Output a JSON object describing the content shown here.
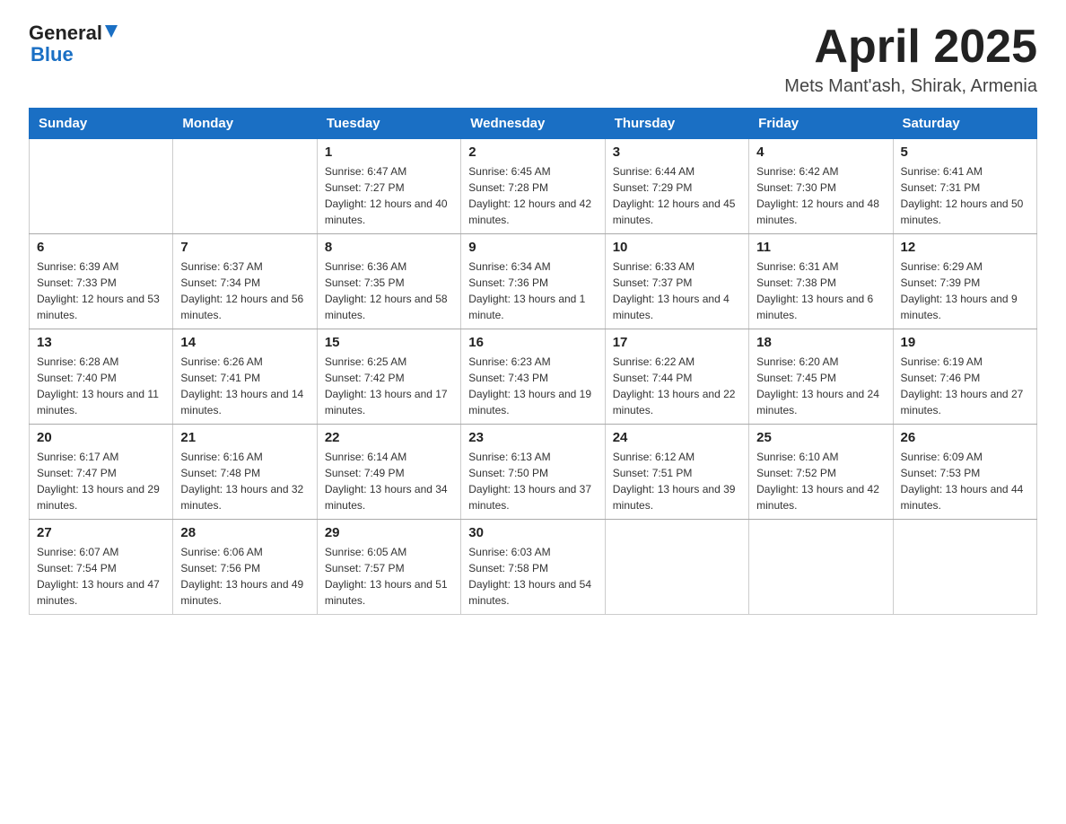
{
  "logo": {
    "general": "General",
    "blue": "Blue"
  },
  "title": "April 2025",
  "subtitle": "Mets Mant'ash, Shirak, Armenia",
  "weekdays": [
    "Sunday",
    "Monday",
    "Tuesday",
    "Wednesday",
    "Thursday",
    "Friday",
    "Saturday"
  ],
  "weeks": [
    [
      {
        "day": "",
        "sunrise": "",
        "sunset": "",
        "daylight": ""
      },
      {
        "day": "",
        "sunrise": "",
        "sunset": "",
        "daylight": ""
      },
      {
        "day": "1",
        "sunrise": "Sunrise: 6:47 AM",
        "sunset": "Sunset: 7:27 PM",
        "daylight": "Daylight: 12 hours and 40 minutes."
      },
      {
        "day": "2",
        "sunrise": "Sunrise: 6:45 AM",
        "sunset": "Sunset: 7:28 PM",
        "daylight": "Daylight: 12 hours and 42 minutes."
      },
      {
        "day": "3",
        "sunrise": "Sunrise: 6:44 AM",
        "sunset": "Sunset: 7:29 PM",
        "daylight": "Daylight: 12 hours and 45 minutes."
      },
      {
        "day": "4",
        "sunrise": "Sunrise: 6:42 AM",
        "sunset": "Sunset: 7:30 PM",
        "daylight": "Daylight: 12 hours and 48 minutes."
      },
      {
        "day": "5",
        "sunrise": "Sunrise: 6:41 AM",
        "sunset": "Sunset: 7:31 PM",
        "daylight": "Daylight: 12 hours and 50 minutes."
      }
    ],
    [
      {
        "day": "6",
        "sunrise": "Sunrise: 6:39 AM",
        "sunset": "Sunset: 7:33 PM",
        "daylight": "Daylight: 12 hours and 53 minutes."
      },
      {
        "day": "7",
        "sunrise": "Sunrise: 6:37 AM",
        "sunset": "Sunset: 7:34 PM",
        "daylight": "Daylight: 12 hours and 56 minutes."
      },
      {
        "day": "8",
        "sunrise": "Sunrise: 6:36 AM",
        "sunset": "Sunset: 7:35 PM",
        "daylight": "Daylight: 12 hours and 58 minutes."
      },
      {
        "day": "9",
        "sunrise": "Sunrise: 6:34 AM",
        "sunset": "Sunset: 7:36 PM",
        "daylight": "Daylight: 13 hours and 1 minute."
      },
      {
        "day": "10",
        "sunrise": "Sunrise: 6:33 AM",
        "sunset": "Sunset: 7:37 PM",
        "daylight": "Daylight: 13 hours and 4 minutes."
      },
      {
        "day": "11",
        "sunrise": "Sunrise: 6:31 AM",
        "sunset": "Sunset: 7:38 PM",
        "daylight": "Daylight: 13 hours and 6 minutes."
      },
      {
        "day": "12",
        "sunrise": "Sunrise: 6:29 AM",
        "sunset": "Sunset: 7:39 PM",
        "daylight": "Daylight: 13 hours and 9 minutes."
      }
    ],
    [
      {
        "day": "13",
        "sunrise": "Sunrise: 6:28 AM",
        "sunset": "Sunset: 7:40 PM",
        "daylight": "Daylight: 13 hours and 11 minutes."
      },
      {
        "day": "14",
        "sunrise": "Sunrise: 6:26 AM",
        "sunset": "Sunset: 7:41 PM",
        "daylight": "Daylight: 13 hours and 14 minutes."
      },
      {
        "day": "15",
        "sunrise": "Sunrise: 6:25 AM",
        "sunset": "Sunset: 7:42 PM",
        "daylight": "Daylight: 13 hours and 17 minutes."
      },
      {
        "day": "16",
        "sunrise": "Sunrise: 6:23 AM",
        "sunset": "Sunset: 7:43 PM",
        "daylight": "Daylight: 13 hours and 19 minutes."
      },
      {
        "day": "17",
        "sunrise": "Sunrise: 6:22 AM",
        "sunset": "Sunset: 7:44 PM",
        "daylight": "Daylight: 13 hours and 22 minutes."
      },
      {
        "day": "18",
        "sunrise": "Sunrise: 6:20 AM",
        "sunset": "Sunset: 7:45 PM",
        "daylight": "Daylight: 13 hours and 24 minutes."
      },
      {
        "day": "19",
        "sunrise": "Sunrise: 6:19 AM",
        "sunset": "Sunset: 7:46 PM",
        "daylight": "Daylight: 13 hours and 27 minutes."
      }
    ],
    [
      {
        "day": "20",
        "sunrise": "Sunrise: 6:17 AM",
        "sunset": "Sunset: 7:47 PM",
        "daylight": "Daylight: 13 hours and 29 minutes."
      },
      {
        "day": "21",
        "sunrise": "Sunrise: 6:16 AM",
        "sunset": "Sunset: 7:48 PM",
        "daylight": "Daylight: 13 hours and 32 minutes."
      },
      {
        "day": "22",
        "sunrise": "Sunrise: 6:14 AM",
        "sunset": "Sunset: 7:49 PM",
        "daylight": "Daylight: 13 hours and 34 minutes."
      },
      {
        "day": "23",
        "sunrise": "Sunrise: 6:13 AM",
        "sunset": "Sunset: 7:50 PM",
        "daylight": "Daylight: 13 hours and 37 minutes."
      },
      {
        "day": "24",
        "sunrise": "Sunrise: 6:12 AM",
        "sunset": "Sunset: 7:51 PM",
        "daylight": "Daylight: 13 hours and 39 minutes."
      },
      {
        "day": "25",
        "sunrise": "Sunrise: 6:10 AM",
        "sunset": "Sunset: 7:52 PM",
        "daylight": "Daylight: 13 hours and 42 minutes."
      },
      {
        "day": "26",
        "sunrise": "Sunrise: 6:09 AM",
        "sunset": "Sunset: 7:53 PM",
        "daylight": "Daylight: 13 hours and 44 minutes."
      }
    ],
    [
      {
        "day": "27",
        "sunrise": "Sunrise: 6:07 AM",
        "sunset": "Sunset: 7:54 PM",
        "daylight": "Daylight: 13 hours and 47 minutes."
      },
      {
        "day": "28",
        "sunrise": "Sunrise: 6:06 AM",
        "sunset": "Sunset: 7:56 PM",
        "daylight": "Daylight: 13 hours and 49 minutes."
      },
      {
        "day": "29",
        "sunrise": "Sunrise: 6:05 AM",
        "sunset": "Sunset: 7:57 PM",
        "daylight": "Daylight: 13 hours and 51 minutes."
      },
      {
        "day": "30",
        "sunrise": "Sunrise: 6:03 AM",
        "sunset": "Sunset: 7:58 PM",
        "daylight": "Daylight: 13 hours and 54 minutes."
      },
      {
        "day": "",
        "sunrise": "",
        "sunset": "",
        "daylight": ""
      },
      {
        "day": "",
        "sunrise": "",
        "sunset": "",
        "daylight": ""
      },
      {
        "day": "",
        "sunrise": "",
        "sunset": "",
        "daylight": ""
      }
    ]
  ]
}
